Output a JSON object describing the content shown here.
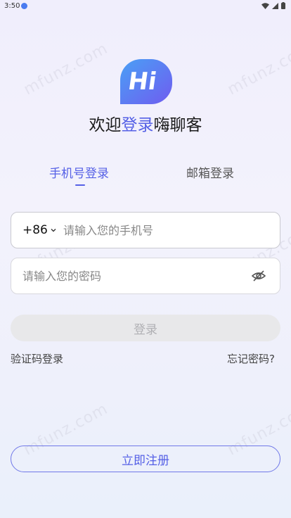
{
  "status_bar": {
    "time": "3:50"
  },
  "logo": {
    "text": "Hi"
  },
  "welcome": {
    "prefix": "欢迎",
    "accent": "登录",
    "suffix": "嗨聊客"
  },
  "tabs": [
    {
      "label": "手机号登录",
      "active": true
    },
    {
      "label": "邮箱登录",
      "active": false
    }
  ],
  "phone": {
    "country_code": "+86",
    "placeholder": "请输入您的手机号",
    "value": ""
  },
  "password": {
    "placeholder": "请输入您的密码",
    "value": ""
  },
  "actions": {
    "login_label": "登录",
    "code_login_label": "验证码登录",
    "forgot_label": "忘记密码?",
    "register_label": "立即注册"
  },
  "watermark": {
    "text": "mfunz.com"
  },
  "colors": {
    "accent": "#5560e6",
    "logo_gradient_start": "#4aa0f5",
    "logo_gradient_end": "#6f5cf0"
  },
  "icons": {
    "chevron": "chevron-down-icon",
    "eye": "eye-off-icon"
  }
}
